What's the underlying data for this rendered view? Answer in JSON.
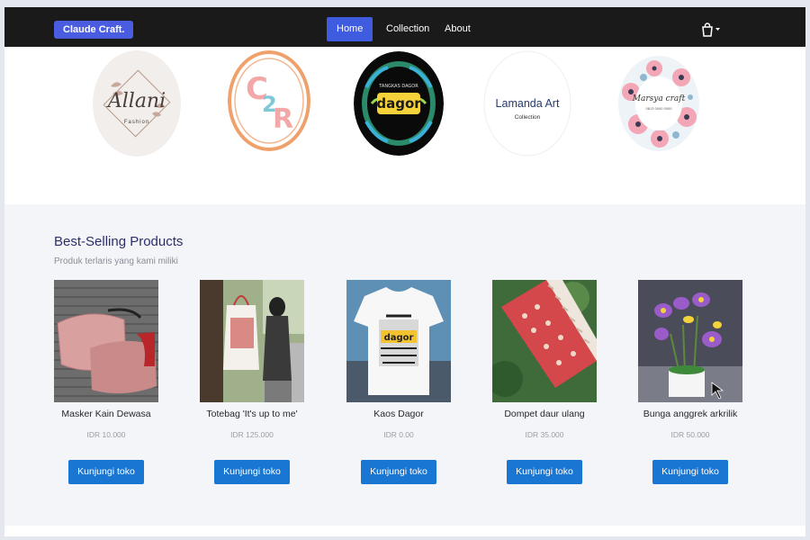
{
  "navbar": {
    "brand": "Claude Craft.",
    "links": [
      {
        "label": "Home",
        "active": true
      },
      {
        "label": "Collection",
        "active": false
      },
      {
        "label": "About",
        "active": false
      }
    ],
    "cart_icon": "shopping-bag-icon"
  },
  "partners": [
    {
      "name": "Allani",
      "subtitle": "Fashion"
    },
    {
      "name": "C2R",
      "subtitle": ""
    },
    {
      "name": "Dagor",
      "top": "TANGKAS DAGOR",
      "subtitle": ""
    },
    {
      "name": "Lamanda Art",
      "subtitle": "Collection"
    },
    {
      "name": "Marsya craft",
      "subtitle": ""
    }
  ],
  "products_section": {
    "title": "Best-Selling Products",
    "subtitle": "Produk terlaris yang kami miliki",
    "button_label": "Kunjungi toko",
    "items": [
      {
        "name": "Masker Kain Dewasa",
        "price": "IDR 10.000"
      },
      {
        "name": "Totebag 'It's up to me'",
        "price": "IDR 125.000"
      },
      {
        "name": "Kaos Dagor",
        "price": "IDR 0.00"
      },
      {
        "name": "Dompet daur ulang",
        "price": "IDR 35.000"
      },
      {
        "name": "Bunga anggrek arkrilik",
        "price": "IDR 50.000"
      }
    ]
  },
  "colors": {
    "navbar_bg": "#1a1a1a",
    "brand_bg": "#4a5de0",
    "active_link_bg": "#3f5be0",
    "button_bg": "#1976d2",
    "section_bg": "#f4f5f9",
    "title_color": "#2b2f6b"
  }
}
